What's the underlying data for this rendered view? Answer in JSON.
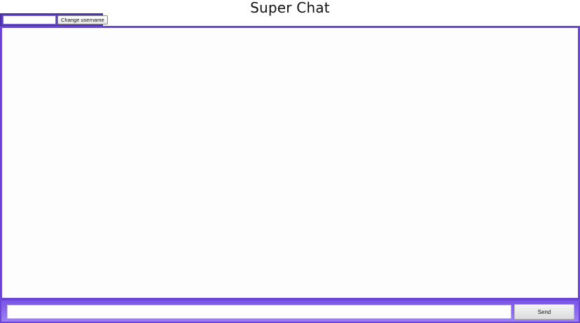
{
  "header": {
    "title": "Super Chat"
  },
  "username": {
    "input_value": "",
    "change_button_label": "Change username"
  },
  "compose": {
    "input_value": "",
    "send_button_label": "Send"
  },
  "colors": {
    "accent": "#6b46d6",
    "accent_dark": "#4a2fa6",
    "accent_light": "#9d80f2"
  }
}
